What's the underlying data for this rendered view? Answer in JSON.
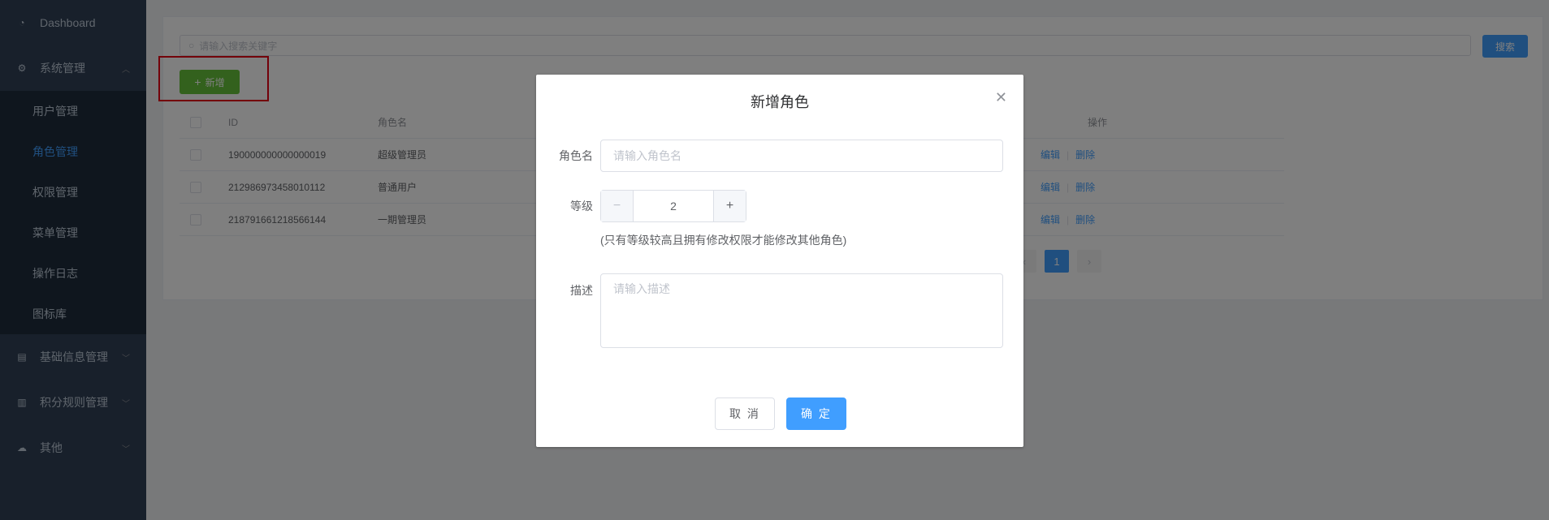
{
  "sidebar": {
    "items": [
      {
        "label": "Dashboard",
        "icon": "dashboard-icon"
      },
      {
        "label": "系统管理",
        "icon": "gear-icon",
        "expanded": true,
        "children": [
          {
            "label": "用户管理"
          },
          {
            "label": "角色管理",
            "active": true
          },
          {
            "label": "权限管理"
          },
          {
            "label": "菜单管理"
          },
          {
            "label": "操作日志"
          },
          {
            "label": "图标库"
          }
        ]
      },
      {
        "label": "基础信息管理",
        "icon": "document-icon"
      },
      {
        "label": "积分规则管理",
        "icon": "bar-chart-icon"
      },
      {
        "label": "其他",
        "icon": "cloud-icon"
      }
    ]
  },
  "toolbar": {
    "search_placeholder": "请输入搜索关键字",
    "search_label": "搜索",
    "add_label": "新增"
  },
  "table": {
    "headers": {
      "id": "ID",
      "name": "角色名",
      "ops": "操作"
    },
    "rows": [
      {
        "id": "190000000000000019",
        "name": "超级管理员",
        "edit": "编辑",
        "delete": "删除"
      },
      {
        "id": "212986973458010112",
        "name": "普通用户",
        "edit": "编辑",
        "delete": "删除"
      },
      {
        "id": "218791661218566144",
        "name": "一期管理员",
        "edit": "编辑",
        "delete": "删除"
      }
    ]
  },
  "pager": {
    "prev": "‹",
    "current": "1",
    "next": "›"
  },
  "dialog": {
    "title": "新增角色",
    "role_name_label": "角色名",
    "role_name_placeholder": "请输入角色名",
    "level_label": "等级",
    "level_value": "2",
    "level_hint": "(只有等级较高且拥有修改权限才能修改其他角色)",
    "desc_label": "描述",
    "desc_placeholder": "请输入描述",
    "cancel_label": "取 消",
    "ok_label": "确 定"
  },
  "colors": {
    "sidebar_bg": "#304156",
    "submenu_bg": "#1f2d3d",
    "primary": "#409eff",
    "success": "#67c23a",
    "highlight": "#e60012"
  }
}
